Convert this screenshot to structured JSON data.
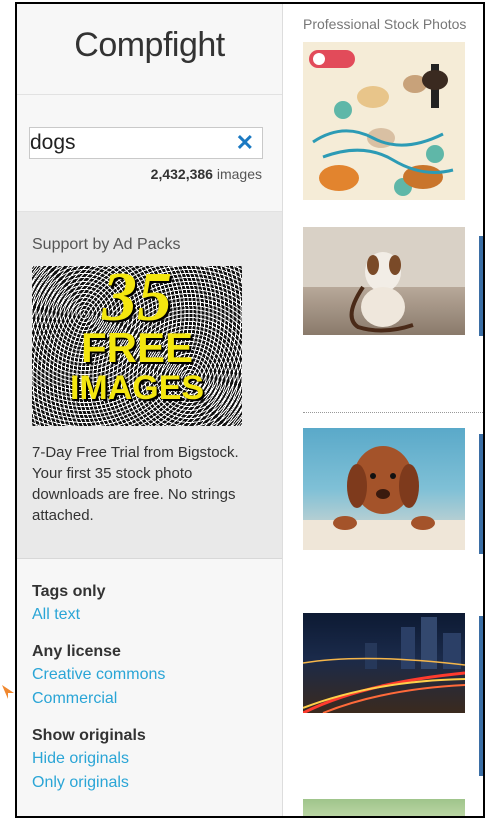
{
  "sidebar": {
    "logo": "Compfight",
    "search": {
      "value": "dogs",
      "clear_glyph": "✕"
    },
    "result_count": "2,432,386",
    "result_unit": "images",
    "ad": {
      "title": "Support by Ad Packs",
      "image_number": "35",
      "image_free": "FREE",
      "image_images": "IMAGES",
      "description": "7-Day Free Trial from Bigstock. Your first 35 stock photo downloads are free. No strings attached."
    },
    "filters": [
      {
        "heading": "Tags only",
        "links": [
          "All text"
        ]
      },
      {
        "heading": "Any license",
        "links": [
          "Creative commons",
          "Commercial"
        ]
      },
      {
        "heading": "Show originals",
        "links": [
          "Hide originals",
          "Only originals"
        ]
      }
    ]
  },
  "results": {
    "label": "Professional Stock Photos"
  },
  "colors": {
    "accent": "#2aa5d6",
    "clear_x": "#1b79c2",
    "ad_yellow": "#f3e60f",
    "arrow": "#f0882f"
  }
}
